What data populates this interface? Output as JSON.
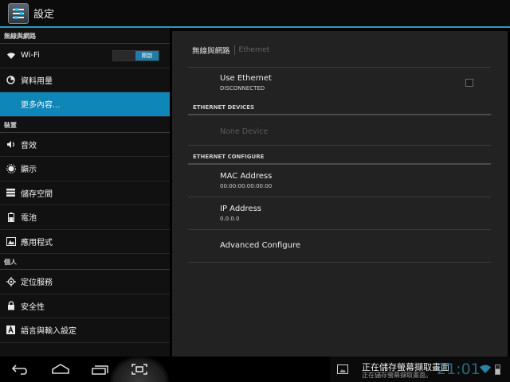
{
  "actionbar": {
    "title": "設定"
  },
  "sidebar": {
    "sections": [
      {
        "header": "無線與網路",
        "items": [
          {
            "label": "Wi-Fi",
            "icon": "wifi-icon",
            "toggle": "開啟"
          },
          {
            "label": "資料用量",
            "icon": "data-usage-icon"
          },
          {
            "label": "更多內容...",
            "selected": true
          }
        ]
      },
      {
        "header": "裝置",
        "items": [
          {
            "label": "音效",
            "icon": "volume-icon"
          },
          {
            "label": "顯示",
            "icon": "brightness-icon"
          },
          {
            "label": "儲存空間",
            "icon": "storage-icon"
          },
          {
            "label": "電池",
            "icon": "battery-icon"
          },
          {
            "label": "應用程式",
            "icon": "apps-icon"
          }
        ]
      },
      {
        "header": "個人",
        "items": [
          {
            "label": "定位服務",
            "icon": "location-icon"
          },
          {
            "label": "安全性",
            "icon": "lock-icon"
          },
          {
            "label": "語言與輸入設定",
            "icon": "keyboard-a-icon"
          }
        ]
      }
    ]
  },
  "main": {
    "breadcrumb": {
      "parent": "無線與網路",
      "current": "Ethernet"
    },
    "use_ethernet": {
      "title": "Use Ethernet",
      "summary": "DISCONNECTED",
      "checked": false
    },
    "devices_header": "ETHERNET DEVICES",
    "none_device": "None Device",
    "configure_header": "ETHERNET CONFIGURE",
    "mac": {
      "title": "MAC Address",
      "value": "00:00:00:00:00:00"
    },
    "ip": {
      "title": "IP Address",
      "value": "0.0.0.0"
    },
    "advanced": {
      "title": "Advanced Configure"
    }
  },
  "statusbar": {
    "notification_title": "正在儲存螢幕擷取畫面",
    "notification_sub": "正在儲存螢幕擷取畫面。",
    "clock": "21:01"
  },
  "colors": {
    "accent": "#33b5e5",
    "selected": "#0e86b8"
  }
}
